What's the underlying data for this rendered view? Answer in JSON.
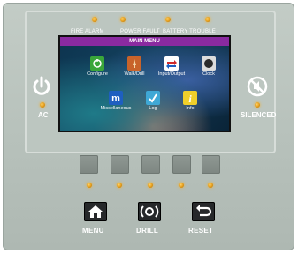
{
  "indicators": {
    "top": [
      {
        "label": "FIRE ALARM"
      },
      {
        "label": "POWER FAULT"
      },
      {
        "label": "BATTERY TROUBLE"
      }
    ],
    "left_label": "AC",
    "right_label": "SILENCED"
  },
  "screen": {
    "title": "MAIN MENU",
    "apps": [
      {
        "label": "Configure",
        "icon": "gear-icon",
        "color": "#3aa63a"
      },
      {
        "label": "Walk/Drill",
        "icon": "walk-icon",
        "color": "#c8632a"
      },
      {
        "label": "Input/Output",
        "icon": "input-output-icon",
        "color": "#ffffff"
      },
      {
        "label": "Clock",
        "icon": "clock-icon",
        "color": "#dcdcdc"
      },
      {
        "label": "Miscellaneous",
        "icon": "misc-icon",
        "color": "#1e5fc0"
      },
      {
        "label": "Log",
        "icon": "log-icon",
        "color": "#3fa8d6"
      },
      {
        "label": "Info",
        "icon": "info-icon",
        "color": "#f0cf2a"
      }
    ]
  },
  "buttons": {
    "menu": "MENU",
    "drill": "DRILL",
    "reset": "RESET"
  },
  "colors": {
    "panel": "#bcc6c0",
    "led": "#e39a16",
    "title_bar": "#8a2aa0"
  }
}
